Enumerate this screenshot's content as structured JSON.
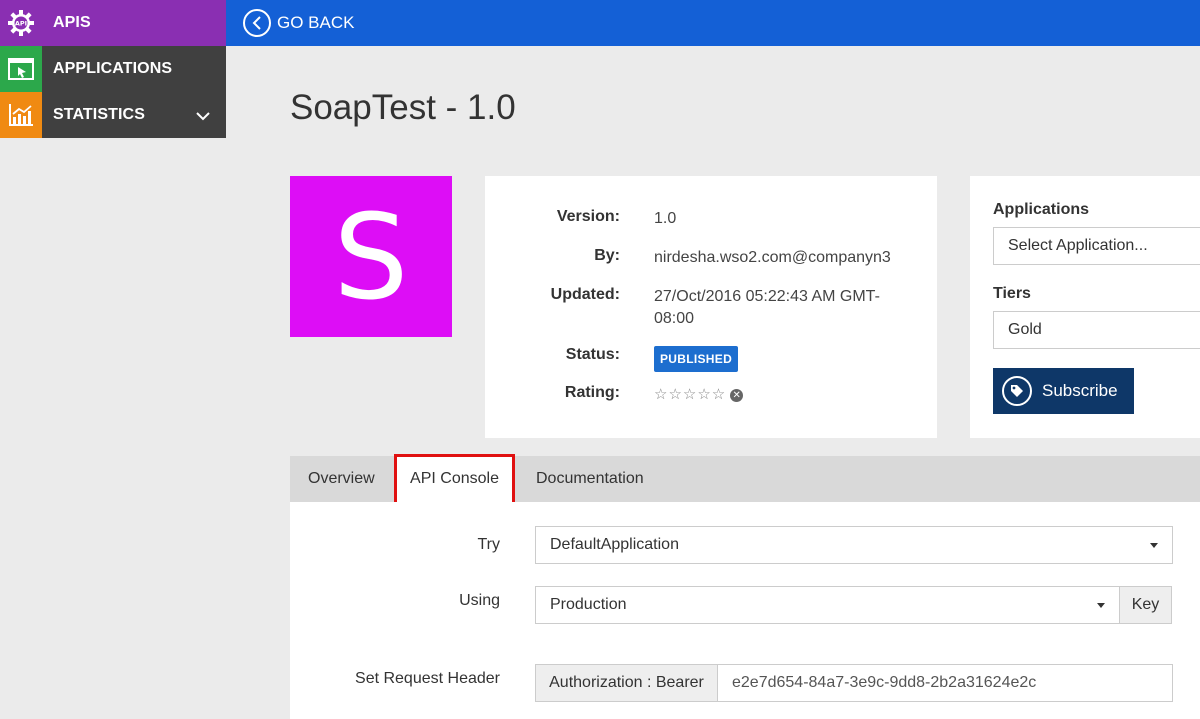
{
  "nav": {
    "items": [
      {
        "label": "APIS",
        "icon": "api-gear-icon",
        "color": "#8a2fb2"
      },
      {
        "label": "APPLICATIONS",
        "icon": "application-window-icon",
        "color": "#2ca84b"
      },
      {
        "label": "STATISTICS",
        "icon": "bar-chart-icon",
        "color": "#f08a12"
      }
    ]
  },
  "topbar": {
    "go_back": "GO BACK"
  },
  "api": {
    "title": "SoapTest - 1.0",
    "thumbnail_letter": "S",
    "thumbnail_color": "#dd0df6",
    "version_label": "Version:",
    "version": "1.0",
    "by_label": "By:",
    "by": "nirdesha.wso2.com@companyn3",
    "updated_label": "Updated:",
    "updated": "27/Oct/2016 05:22:43 AM GMT-08:00",
    "status_label": "Status:",
    "status": "PUBLISHED",
    "rating_label": "Rating:",
    "rating_stars": "☆☆☆☆☆"
  },
  "subscribe": {
    "applications_label": "Applications",
    "application_placeholder": "Select Application...",
    "tiers_label": "Tiers",
    "tier": "Gold",
    "button": "Subscribe"
  },
  "tabs": [
    {
      "label": "Overview"
    },
    {
      "label": "API Console"
    },
    {
      "label": "Documentation"
    }
  ],
  "console": {
    "try_label": "Try",
    "try_value": "DefaultApplication",
    "using_label": "Using",
    "using_value": "Production",
    "key_button": "Key",
    "header_label": "Set Request Header",
    "header_addon": "Authorization : Bearer",
    "header_value": "e2e7d654-84a7-3e9c-9dd8-2b2a31624e2c"
  }
}
